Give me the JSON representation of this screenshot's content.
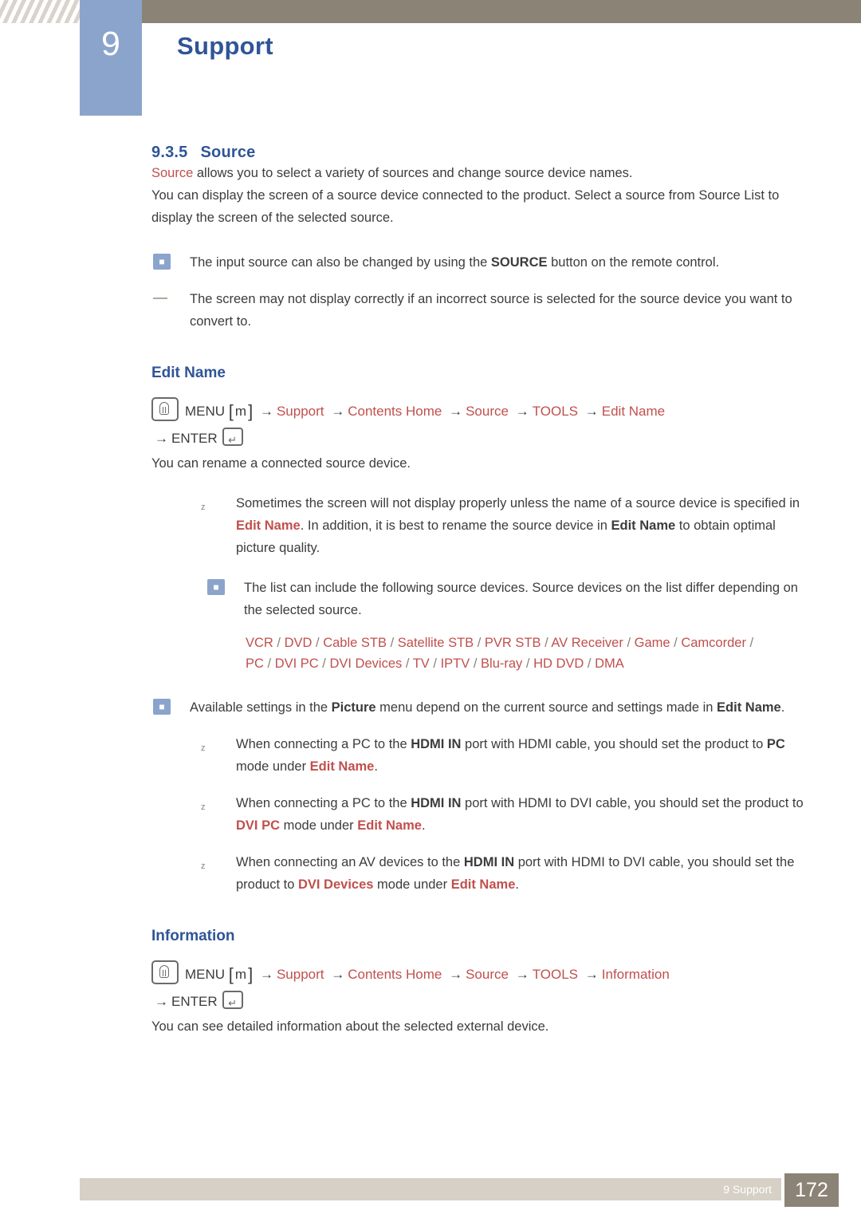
{
  "header": {
    "chapter_number": "9",
    "chapter_title": "Support"
  },
  "section": {
    "number": "9.3.5",
    "title": "Source"
  },
  "intro": {
    "line1_kw": "Source",
    "line1_rest": " allows you to select a variety of sources and change source device names.",
    "para2": "You can display the screen of a source device connected to the product. Select a source from Source List to display the screen of the selected source."
  },
  "notes_top": [
    {
      "icon": "note-icon",
      "pre": "The input source can also be changed by using the ",
      "kw": "SOURCE",
      "post": " button on the remote control."
    },
    {
      "icon": "dash-icon",
      "text": "The screen may not display correctly if an incorrect source is selected for the source device you want to convert to."
    }
  ],
  "edit_name": {
    "heading": "Edit Name",
    "menu_label": "MENU",
    "menu_glyph": "m",
    "bracket_open": "[",
    "bracket_close": "]",
    "arrow": "→",
    "path": [
      "Support",
      "Contents Home",
      "Source",
      "TOOLS",
      "Edit Name"
    ],
    "enter_label": "ENTER",
    "description": "You can rename a connected source device.",
    "bullet1": {
      "pre": "Sometimes the screen will not display properly unless the name of a source device is specified in ",
      "kw1": "Edit Name",
      "mid": ". In addition, it is best to rename the source device in ",
      "kw2": "Edit Name",
      "post": " to obtain optimal picture quality."
    },
    "note_list": "The list can include the following source devices. Source devices on the list differ depending on the selected source.",
    "device_line1": [
      "VCR",
      "DVD",
      "Cable STB",
      "Satellite STB",
      "PVR STB",
      "AV Receiver",
      "Game",
      "Camcorder",
      ""
    ],
    "device_line2": [
      "PC",
      "DVI PC",
      "DVI Devices",
      "TV",
      "IPTV",
      "Blu-ray",
      "HD DVD",
      "DMA"
    ],
    "note_picture": {
      "pre": "Available settings in the ",
      "kw1": "Picture",
      "mid": " menu depend on the current source and settings made in ",
      "kw2": "Edit Name",
      "post": "."
    },
    "bullets": [
      {
        "pre": "When connecting a PC to the ",
        "kw1": "HDMI IN",
        "mid": " port with HDMI cable, you should set the product to ",
        "kw2": "PC",
        "mid2": " mode under ",
        "kw3": "Edit Name",
        "post": "."
      },
      {
        "pre": "When connecting a PC to the ",
        "kw1": "HDMI IN",
        "mid": " port with HDMI to DVI cable, you should set the product to ",
        "kw2": "DVI PC",
        "mid2": " mode under ",
        "kw3": "Edit Name",
        "post": "."
      },
      {
        "pre": "When connecting an AV devices to the ",
        "kw1": "HDMI IN",
        "mid": " port with HDMI to DVI cable, you should set the product to ",
        "kw2": "DVI Devices",
        "mid2": " mode under ",
        "kw3": "Edit Name",
        "post": "."
      }
    ]
  },
  "information": {
    "heading": "Information",
    "menu_label": "MENU",
    "menu_glyph": "m",
    "bracket_open": "[",
    "bracket_close": "]",
    "path": [
      "Support",
      "Contents Home",
      "Source",
      "TOOLS",
      "Information"
    ],
    "enter_label": "ENTER",
    "description": "You can see detailed information about the selected external device."
  },
  "footer": {
    "text": "9 Support",
    "page": "172"
  },
  "colors": {
    "accent_red": "#c0504d",
    "heading_blue": "#2f5597",
    "chapter_blue": "#8ba4cc",
    "bar_brown": "#8b8376",
    "footer_bar": "#d6d0c6"
  }
}
